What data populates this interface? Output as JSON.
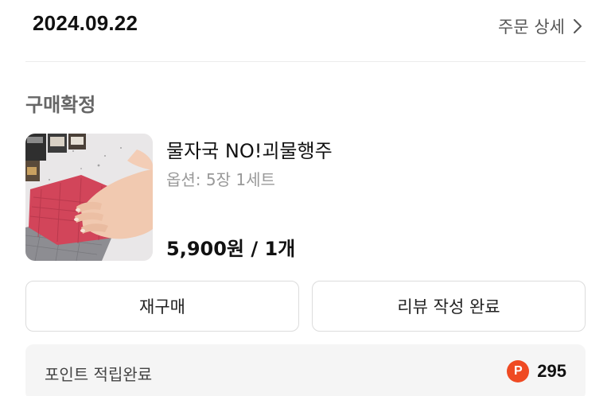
{
  "header": {
    "order_date": "2024.09.22",
    "detail_label": "주문 상세"
  },
  "order": {
    "status": "구매확정",
    "product": {
      "name": "물자국 NO!괴물행주",
      "option": "옵션: 5장 1세트",
      "price_qty": "5,900원 / 1개"
    }
  },
  "actions": {
    "rebuy_label": "재구매",
    "review_label": "리뷰 작성 완료"
  },
  "points": {
    "label": "포인트 적립완료",
    "icon_letter": "P",
    "amount": "295"
  },
  "colors": {
    "point_icon": "#ef4a23",
    "status_text": "#666666",
    "option_text": "#999999"
  },
  "icons": {
    "detail_chevron": "chevron-right-icon",
    "point_badge": "point-icon"
  }
}
